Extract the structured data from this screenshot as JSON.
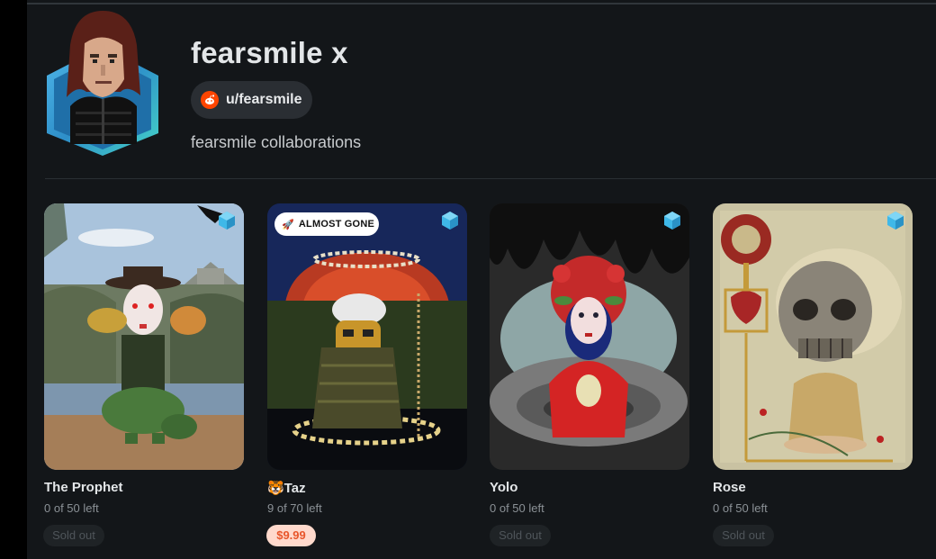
{
  "profile": {
    "name": "fearsmile x",
    "handle": "u/fearsmile",
    "description": "fearsmile collaborations"
  },
  "colors": {
    "accent_reddit": "#ff4500",
    "price_badge_bg": "#ffd9cc",
    "price_badge_text": "#e8552a",
    "page_bg": "#131619"
  },
  "cards": [
    {
      "title": "The Prophet",
      "availability": "0 of 50 left",
      "status": "Sold out",
      "icon": "polygon-icon"
    },
    {
      "title": "🐯Taz",
      "availability": "9 of 70 left",
      "price": "$9.99",
      "badge": "ALMOST GONE",
      "badge_icon": "rocket-icon",
      "icon": "polygon-icon"
    },
    {
      "title": "Yolo",
      "availability": "0 of 50 left",
      "status": "Sold out",
      "icon": "polygon-icon"
    },
    {
      "title": "Rose",
      "availability": "0 of 50 left",
      "status": "Sold out",
      "icon": "polygon-icon"
    }
  ]
}
